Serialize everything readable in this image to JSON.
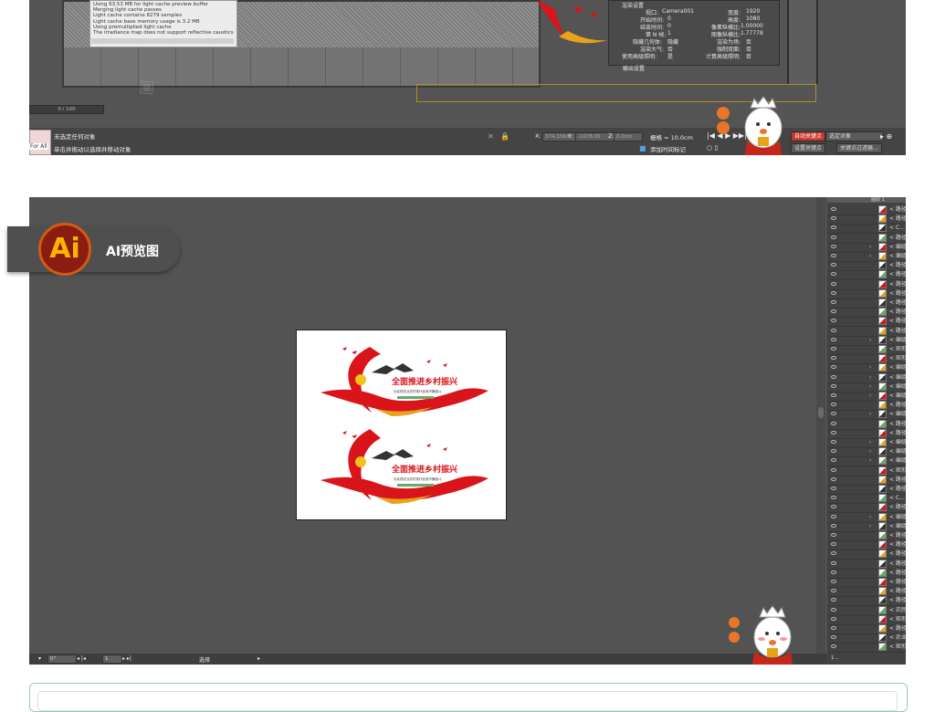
{
  "max": {
    "log_lines": [
      "Using 63.53 MB for light cache preview buffer",
      "Merging light cache passes",
      "Light cache contains 8279 samples",
      "Light cache base memory usage is 3.2 MB",
      "Using premultiplied light cache",
      "The irradiance map does not support reflective caustics; the"
    ],
    "progress": "0 / 100",
    "render_dialog": {
      "title": "渲染设置",
      "viewport_label": "视口:",
      "viewport": "Camera001",
      "width_label": "宽度:",
      "width": "1920",
      "start_label": "开始时间:",
      "start": "0",
      "height_label": "高度:",
      "height": "1080",
      "end_label": "结束时间:",
      "end": "0",
      "pixel_aspect_label": "像素纵横比:",
      "pixel_aspect": "1.00000",
      "nth_label": "第 N 帧:",
      "nth": "1",
      "image_aspect_label": "图像纵横比:",
      "image_aspect": "1.77778",
      "hidden_label": "隐藏几何体:",
      "hidden": "隐藏",
      "render_label": "渲染为场:",
      "render_val": "否",
      "atmos_label": "渲染大气:",
      "atmos": "否",
      "force_label": "强制双面:",
      "force": "否",
      "adv_label": "使用高级照明:",
      "adv": "是",
      "calc_label": "计算高级照明:",
      "calc": "否",
      "output_label": "输出设置"
    },
    "status": {
      "selection": "未选定任何对象",
      "hint": "单击并拖动以选择并移动对象",
      "for_all": "For All",
      "x_label": "X:",
      "x_value": "374.156m",
      "y_label": "Y:",
      "y_value": "-1078.09",
      "z_label": "Z:",
      "z_value": "0.0cm",
      "grid": "栅格 = 10.0cm",
      "add_tag": "添加时间标记",
      "auto_key": "自动关键点",
      "selected": "选定对象",
      "set_key": "设置关键点",
      "key_filter": "关键点过滤器..."
    }
  },
  "badge": {
    "logo": "Ai",
    "label": "AI预览图"
  },
  "ai": {
    "artwork": {
      "headline": "全面推进乡村振兴",
      "subline": "为实现农业农村现代化而不懈奋斗"
    },
    "bottom": {
      "zoom": "0°",
      "page": "1",
      "tool": "选择"
    },
    "layers_header": "图层 1",
    "layers": [
      "路径",
      "路径",
      "C...",
      "路径",
      "编组",
      "编组",
      "路径",
      "路径",
      "路径",
      "路径",
      "路径",
      "路径",
      "路径",
      "路径",
      "编组",
      "矩形",
      "矩形",
      "编组",
      "编组",
      "编组",
      "编组",
      "路径",
      "编组",
      "路径",
      "路径",
      "编组",
      "编组",
      "编组",
      "矩形",
      "路径",
      "路径",
      "C...",
      "路径",
      "编组",
      "编组",
      "路径",
      "路径",
      "路径",
      "路径",
      "路径",
      "路径",
      "路径",
      "路径",
      "农民丰",
      "矩形",
      "路径",
      "农业农",
      "矩形"
    ],
    "layer_count": "1..."
  },
  "colors": {
    "red": "#d9151b",
    "gold": "#e8a21b",
    "badge_red": "#8a1d12",
    "badge_orange": "#d35a12"
  }
}
